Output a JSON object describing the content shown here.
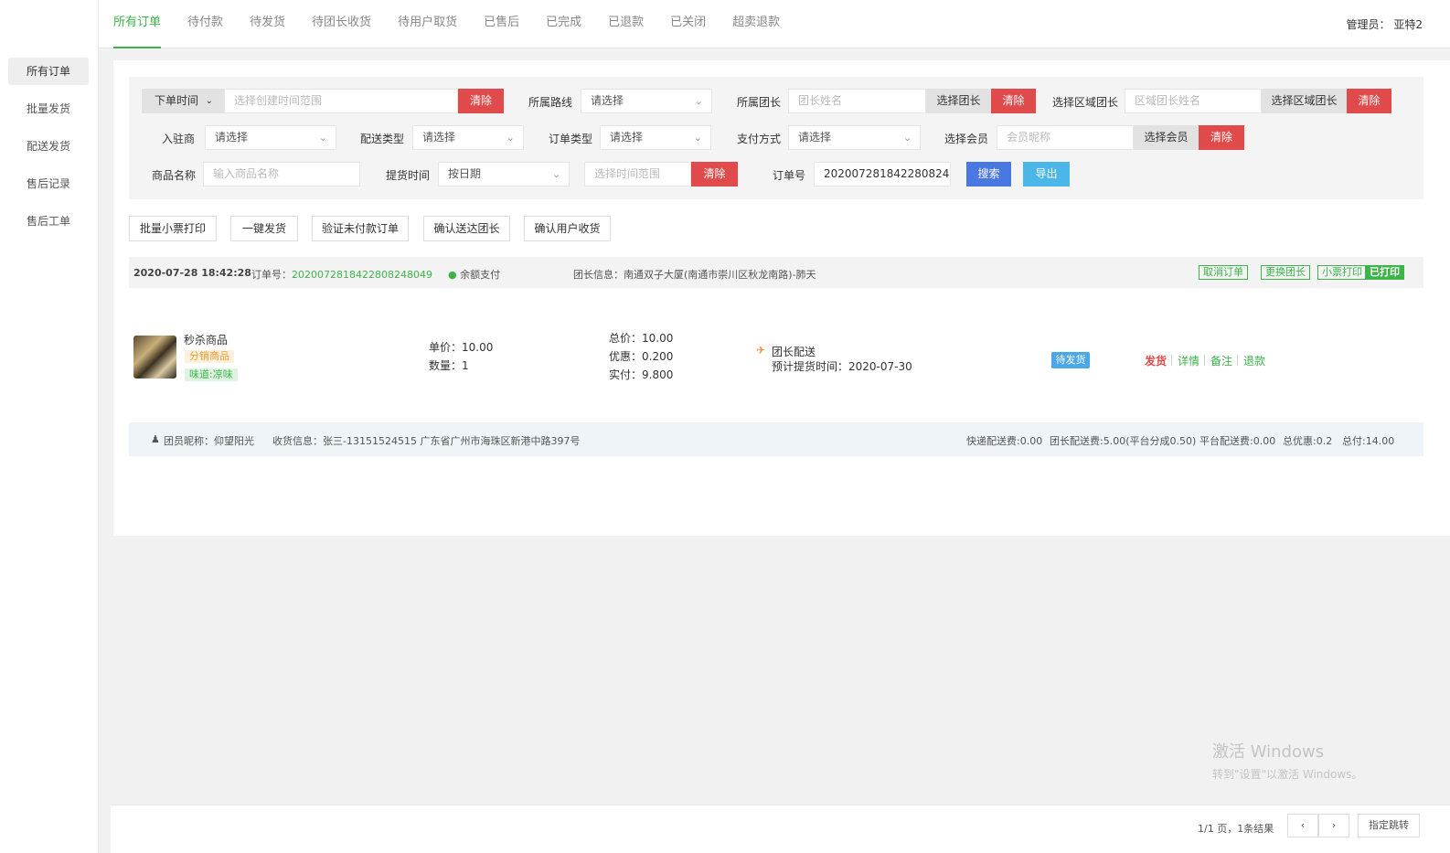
{
  "sidebar": {
    "items": [
      {
        "label": "所有订单",
        "active": true
      },
      {
        "label": "批量发货"
      },
      {
        "label": "配送发货"
      },
      {
        "label": "售后记录"
      },
      {
        "label": "售后工单"
      }
    ]
  },
  "topnav": {
    "tabs": [
      "所有订单",
      "待付款",
      "待发货",
      "待团长收货",
      "待用户取货",
      "已售后",
      "已完成",
      "已退款",
      "已关闭",
      "超卖退款"
    ],
    "active_index": 0,
    "admin": "管理员：  亚特2"
  },
  "filters": {
    "time_dropdown": "下单时间",
    "time_range_placeholder": "选择创建时间范围",
    "clear": "清除",
    "route_label": "所属路线",
    "route_value": "请选择",
    "leader_label": "所属团长",
    "leader_placeholder": "团长姓名",
    "choose_leader": "选择团长",
    "region_label": "选择区域团长",
    "region_placeholder": "区域团长姓名",
    "choose_region": "选择区域团长",
    "supplier_label": "入驻商",
    "supplier_value": "请选择",
    "delivery_type_label": "配送类型",
    "delivery_type_value": "请选择",
    "order_type_label": "订单类型",
    "order_type_value": "请选择",
    "pay_method_label": "支付方式",
    "pay_method_value": "请选择",
    "member_label": "选择会员",
    "member_placeholder": "会员昵称",
    "choose_member": "选择会员",
    "goods_label": "商品名称",
    "goods_placeholder": "输入商品名称",
    "pickup_label": "提货时间",
    "pickup_value": "按日期",
    "pickup_range_placeholder": "选择时间范围",
    "order_no_label": "订单号",
    "order_no_value": "202007281842280824",
    "search": "搜索",
    "export": "导出"
  },
  "actions": [
    "批量小票打印",
    "一键发货",
    "验证未付款订单",
    "确认送达团长",
    "确认用户收货"
  ],
  "order": {
    "time": "2020-07-28 18:42:28",
    "order_no_label": "订单号：",
    "order_no": "2020072818422808248049",
    "pay": "余额支付",
    "leader_info": "团长信息：南通双子大厦(南通市崇川区秋龙南路)-肺天",
    "tags": [
      "取消订单",
      "更换团长",
      "小票打印",
      "已打印"
    ],
    "product_name": "秒杀商品",
    "product_tag1": "分销商品",
    "product_tag2": "味道:凉味",
    "unit_price": "单价：10.00",
    "qty": "数量：1",
    "total": "总价：10.00",
    "discount": "优惠：0.200",
    "paid": "实付：9.800",
    "delivery": "团长配送",
    "pickup_time": "预计提货时间：2020-07-30",
    "status": "待发货",
    "ops": [
      "发货",
      "详情",
      "备注",
      "退款"
    ],
    "member": "团员昵称：仰望阳光",
    "receiver": "收货信息：张三-13151524515    广东省广州市海珠区新港中路397号",
    "express_fee": "快递配送费:0.00",
    "leader_fee": "团长配送费:5.00(平台分成0.50)",
    "platform_fee": "平台配送费:0.00",
    "total_discount": "总优惠:0.2",
    "total_paid": "总付:14.00"
  },
  "pager": {
    "summary": "1/1 页，1条结果",
    "prev": "‹",
    "next": "›",
    "jump": "指定跳转"
  },
  "watermark": {
    "line1": "激活 Windows",
    "line2": "转到\"设置\"以激活 Windows。"
  },
  "colors": {
    "accent": "#3eb34a",
    "danger": "#e04a4a",
    "primary": "#4a78e3",
    "info": "#4ab7e8"
  }
}
